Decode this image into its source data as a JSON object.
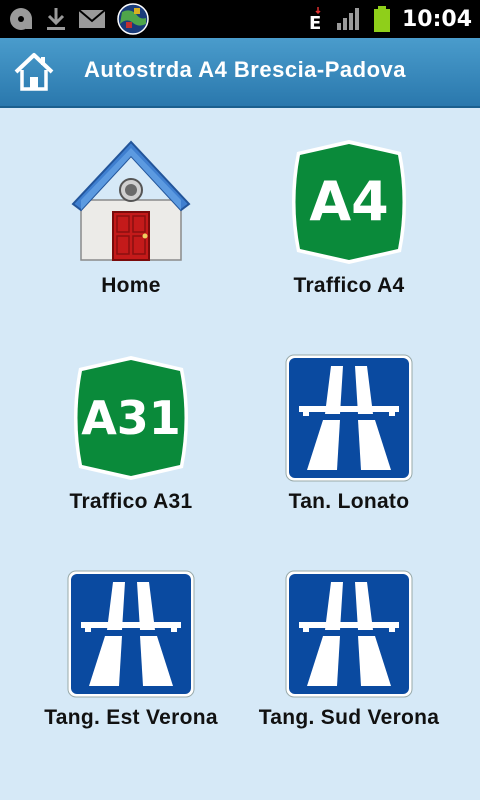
{
  "status_bar": {
    "time": "10:04",
    "icons": [
      "cd-icon",
      "download-icon",
      "mail-icon",
      "globe-icon",
      "data-e-icon",
      "signal-icon",
      "battery-icon"
    ]
  },
  "header": {
    "title": "Autostrda A4 Brescia-Padova",
    "home_icon": "home-icon"
  },
  "tiles": [
    {
      "label": "Home",
      "icon": "house-icon"
    },
    {
      "label": "Traffico A4",
      "icon": "a4-sign-icon",
      "sign_text": "A4"
    },
    {
      "label": "Traffico A31",
      "icon": "a31-sign-icon",
      "sign_text": "A31"
    },
    {
      "label": "Tan. Lonato",
      "icon": "motorway-sign-icon"
    },
    {
      "label": "Tang. Est Verona",
      "icon": "motorway-sign-icon"
    },
    {
      "label": "Tang. Sud Verona",
      "icon": "motorway-sign-icon"
    }
  ],
  "colors": {
    "background": "#d6e9f7",
    "titlebar": "#3d8ec2",
    "sign_green": "#0a8a3a",
    "sign_blue": "#0a4aa0"
  }
}
